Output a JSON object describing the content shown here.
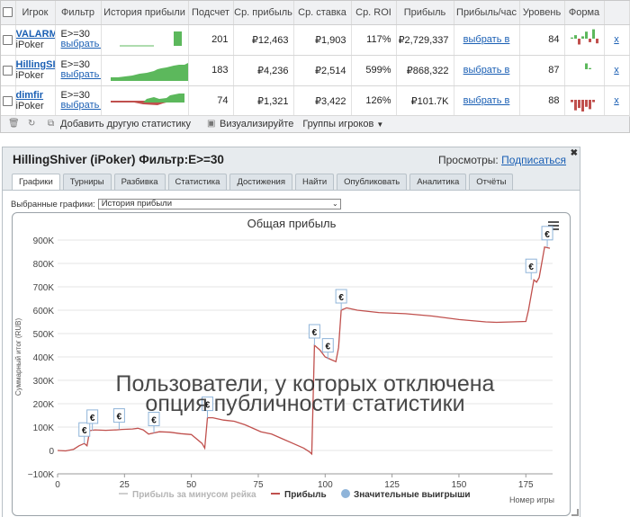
{
  "stats_table": {
    "headers": [
      "",
      "Игрок",
      "Фильтр",
      "История прибыли",
      "Подсчет",
      "Ср. прибыль",
      "Ср. ставка",
      "Ср. ROI",
      "Прибыль",
      "Прибыль/час",
      "Уровень",
      "Форма",
      ""
    ],
    "rows": [
      {
        "name": "VALARM",
        "site": "iPoker",
        "filter": "E>=30",
        "filter_link": "выбрать в",
        "count": "201",
        "avg_profit": "₽12,463",
        "avg_stake": "₽1,903",
        "roi": "117%",
        "profit": "₽2,729,337",
        "per_hour": "выбрать в",
        "level": "84",
        "remove": "x"
      },
      {
        "name": "HillingSI",
        "site": "iPoker",
        "filter": "E>=30",
        "filter_link": "выбрать в",
        "count": "183",
        "avg_profit": "₽4,236",
        "avg_stake": "₽2,514",
        "roi": "599%",
        "profit": "₽868,322",
        "per_hour": "выбрать в",
        "level": "87",
        "remove": "x"
      },
      {
        "name": "dimfir",
        "site": "iPoker",
        "filter": "E>=30",
        "filter_link": "выбрать в",
        "count": "74",
        "avg_profit": "₽1,321",
        "avg_stake": "₽3,422",
        "roi": "126%",
        "profit": "₽101.7K",
        "per_hour": "выбрать в",
        "level": "88",
        "remove": "x"
      }
    ]
  },
  "toolbar": {
    "add_stat": "Добавить другую статистику",
    "visualize": "Визуализируйте",
    "groups": "Группы игроков"
  },
  "panel": {
    "title": "HillingShiver (iPoker) Фильтр:E>=30",
    "views_label": "Просмотры:",
    "subscribe": "Подписаться",
    "close": "✖",
    "tabs": [
      "Графики",
      "Турниры",
      "Разбивка",
      "Статистика",
      "Достижения",
      "Найти",
      "Опубликовать",
      "Аналитика",
      "Отчёты"
    ],
    "select_label": "Выбранные графики:",
    "select_value": "История прибыли",
    "overlay_line1": "Пользователи, у которых отключена",
    "overlay_line2": "опция публичности статистики"
  },
  "chart_data": {
    "type": "line",
    "title": "Общая прибыль",
    "xlabel": "Номер игры",
    "ylabel": "Суммарный итог (RUB)",
    "xlim": [
      0,
      185
    ],
    "ylim": [
      -100000,
      900000
    ],
    "x_ticks": [
      "0",
      "25",
      "50",
      "75",
      "100",
      "125",
      "150",
      "175"
    ],
    "y_ticks": [
      "−100K",
      "0",
      "100K",
      "200K",
      "300K",
      "400K",
      "500K",
      "600K",
      "700K",
      "800K",
      "900K"
    ],
    "legend": [
      "Прибыль за минусом рейка",
      "Прибыль",
      "Значительные выигрыши"
    ],
    "legend_position": "bottom",
    "series": [
      {
        "name": "Прибыль",
        "color": "#c0504d",
        "x": [
          0,
          3,
          6,
          8,
          10,
          11,
          12,
          14,
          18,
          22,
          24,
          28,
          30,
          32,
          34,
          36,
          38,
          42,
          46,
          50,
          54,
          55,
          56,
          58,
          62,
          66,
          70,
          72,
          76,
          80,
          84,
          88,
          92,
          94,
          95,
          96,
          98,
          100,
          102,
          104,
          105,
          106,
          108,
          112,
          120,
          130,
          140,
          150,
          160,
          164,
          170,
          175,
          176,
          178,
          179,
          180,
          182,
          184
        ],
        "y": [
          0,
          -2000,
          5000,
          20000,
          30000,
          20000,
          85000,
          88000,
          86000,
          88000,
          90000,
          92000,
          95000,
          88000,
          70000,
          75000,
          80000,
          78000,
          72000,
          68000,
          30000,
          10000,
          140000,
          140000,
          130000,
          125000,
          110000,
          100000,
          80000,
          70000,
          50000,
          30000,
          10000,
          -5000,
          -15000,
          450000,
          430000,
          400000,
          390000,
          380000,
          440000,
          600000,
          610000,
          600000,
          590000,
          585000,
          575000,
          560000,
          550000,
          548000,
          550000,
          552000,
          600000,
          730000,
          720000,
          740000,
          870000,
          865000
        ]
      }
    ],
    "big_wins": [
      {
        "x": 10,
        "y": 30000
      },
      {
        "x": 13,
        "y": 85000
      },
      {
        "x": 23,
        "y": 90000
      },
      {
        "x": 36,
        "y": 75000
      },
      {
        "x": 56,
        "y": 140000
      },
      {
        "x": 96,
        "y": 450000
      },
      {
        "x": 101,
        "y": 390000
      },
      {
        "x": 106,
        "y": 600000
      },
      {
        "x": 177,
        "y": 730000
      },
      {
        "x": 183,
        "y": 870000
      }
    ],
    "sparklines": [
      {
        "row": 0,
        "style": "green-bars"
      },
      {
        "row": 1,
        "style": "green-area"
      },
      {
        "row": 2,
        "style": "red-green"
      }
    ],
    "form_bars": [
      [
        1,
        3,
        -5,
        2,
        6,
        -3,
        8,
        -4
      ],
      [
        0,
        0,
        0,
        0,
        5,
        1,
        0,
        0
      ],
      [
        -2,
        -9,
        -7,
        -10,
        -6,
        -8,
        -2,
        0
      ]
    ]
  }
}
